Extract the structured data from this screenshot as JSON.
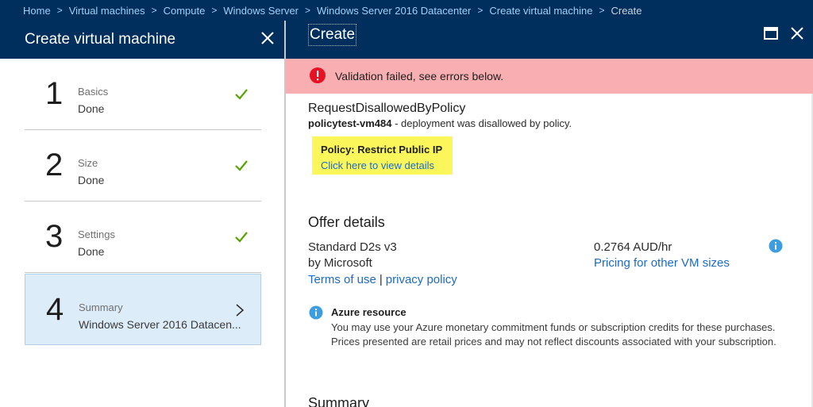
{
  "breadcrumb": [
    {
      "label": "Home"
    },
    {
      "label": "Virtual machines"
    },
    {
      "label": "Compute"
    },
    {
      "label": "Windows Server"
    },
    {
      "label": "Windows Server 2016 Datacenter"
    },
    {
      "label": "Create virtual machine"
    },
    {
      "label": "Create"
    }
  ],
  "left_blade": {
    "title": "Create virtual machine",
    "steps": [
      {
        "number": "1",
        "title": "Basics",
        "status": "Done",
        "state": "complete"
      },
      {
        "number": "2",
        "title": "Size",
        "status": "Done",
        "state": "complete"
      },
      {
        "number": "3",
        "title": "Settings",
        "status": "Done",
        "state": "complete"
      },
      {
        "number": "4",
        "title": "Summary",
        "status": "Windows Server 2016 Datacen...",
        "state": "active"
      }
    ]
  },
  "right_blade": {
    "title": "Create",
    "error_banner": "Validation failed, see errors below.",
    "error_code": "RequestDisallowedByPolicy",
    "error_resource": "policytest-vm484",
    "error_detail": " - deployment was disallowed by policy.",
    "policy": {
      "title": "Policy: Restrict Public IP",
      "link": "Click here to view details"
    },
    "offer": {
      "heading": "Offer details",
      "name": "Standard D2s v3",
      "publisher": "by Microsoft",
      "terms_link": "Terms of use",
      "separator": "|",
      "privacy_link": "privacy policy",
      "price": "0.2764 AUD/hr",
      "pricing_link": "Pricing for other VM sizes"
    },
    "azure_resource": {
      "title": "Azure resource",
      "body": "You may use your Azure monetary commitment funds or subscription credits for these purchases. Prices presented are retail prices and may not reflect discounts associated with your subscription."
    },
    "summary_heading": "Summary"
  },
  "colors": {
    "header_bg": "#002f5e",
    "breadcrumb_link": "#9fd0f7",
    "error_bg": "#f9aeb1",
    "error_icon": "#e81123",
    "highlight": "#fbf75a",
    "link": "#1b6ac9",
    "check": "#57a300",
    "active_step_bg": "#dcecf9",
    "info_icon": "#3c9de0"
  },
  "icons": {
    "close": "close-icon",
    "maximize": "maximize-icon",
    "check": "checkmark-icon",
    "chevron": "chevron-right-icon",
    "error": "error-icon",
    "info": "info-icon"
  }
}
